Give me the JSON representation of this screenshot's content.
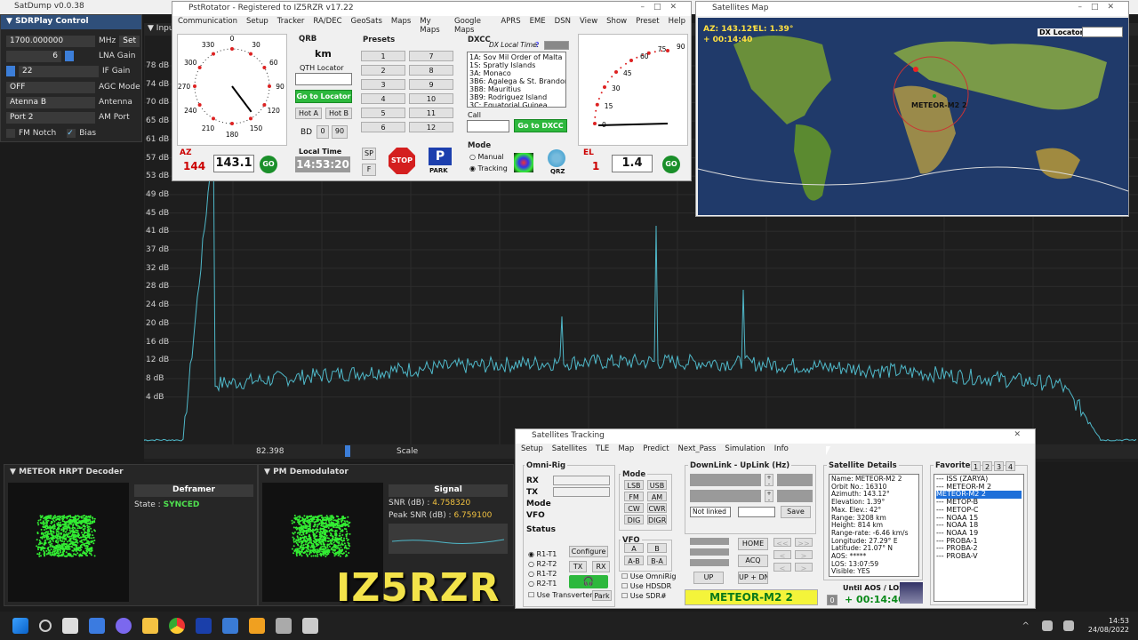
{
  "satdump": {
    "title": "SatDump v0.0.38"
  },
  "sdr": {
    "title": "SDRPlay Control",
    "freq": "1700.000000",
    "freq_unit": "MHz",
    "set": "Set",
    "lna_value": "6",
    "lna_label": "LNA Gain",
    "if_value": "22",
    "if_label": "IF Gain",
    "agc_value": "OFF",
    "agc_label": "AGC Mode",
    "antenna_value": "Atenna B",
    "antenna_label": "Antenna",
    "amport_value": "Port 2",
    "amport_label": "AM Port",
    "fmnotch": "FM Notch",
    "bias": "Bias"
  },
  "spectrum": {
    "input_label": "Inpu",
    "db_labels": [
      "78 dB",
      "74 dB",
      "70 dB",
      "65 dB",
      "61 dB",
      "57 dB",
      "53 dB",
      "49 dB",
      "45 dB",
      "41 dB",
      "37 dB",
      "32 dB",
      "28 dB",
      "24 dB",
      "20 dB",
      "16 dB",
      "12 dB",
      "8 dB",
      "4 dB"
    ],
    "offset": "82.398",
    "scale": "Scale"
  },
  "hrpt": {
    "title": "METEOR HRPT Decoder",
    "deframer": "Deframer",
    "state_label": "State :",
    "state_value": "SYNCED"
  },
  "pm": {
    "title": "PM Demodulator",
    "signal": "Signal",
    "snr_label": "SNR (dB) :",
    "snr_value": "4.758320",
    "peak_label": "Peak SNR (dB) :",
    "peak_value": "6.759100"
  },
  "callsign": "IZ5RZR",
  "rotator": {
    "title": "PstRotator - Registered to IZ5RZR  v17.22",
    "menu": [
      "Communication",
      "Setup",
      "Tracker",
      "RA/DEC",
      "GeoSats",
      "Maps",
      "My Maps",
      "Google Maps",
      "APRS",
      "EME",
      "DSN",
      "View",
      "Show",
      "Preset",
      "Help"
    ],
    "az_ticks": [
      "0",
      "30",
      "60",
      "90",
      "120",
      "150",
      "180",
      "210",
      "240",
      "270",
      "300",
      "330"
    ],
    "az_label": "AZ",
    "az_current": "144",
    "az_target": "143.1",
    "go": "GO",
    "qrb": "QRB",
    "qrb_unit": "km",
    "qth": "QTH Locator",
    "go_locator": "Go to Locator",
    "hot_a": "Hot A",
    "hot_b": "Hot B",
    "bd": "BD",
    "bd0": "0",
    "bd90": "90",
    "local_time_label": "Local Time",
    "local_time": "14:53:20",
    "presets": "Presets",
    "preset_nums": [
      "1",
      "7",
      "2",
      "8",
      "3",
      "9",
      "4",
      "10",
      "5",
      "11",
      "6",
      "12"
    ],
    "sp": "SP",
    "f": "F",
    "stop": "STOP",
    "park": "PARK",
    "dxcc": "DXCC",
    "dx_local_time": "DX Local Time:",
    "q": "?",
    "dxcc_list": [
      "1A:  Sov Mil Order of Malta",
      "1S:  Spratly Islands",
      "3A:  Monaco",
      "3B6: Agalega & St. Brandon",
      "3B8: Mauritius",
      "3B9: Rodriguez Island",
      "3C:  Equatorial Guinea"
    ],
    "call": "Call",
    "go_dxcc": "Go to DXCC",
    "mode": "Mode",
    "manual": "Manual",
    "tracking": "Tracking",
    "qrz": "QRZ",
    "el_ticks": [
      "90",
      "75",
      "60",
      "45",
      "30",
      "15",
      "0"
    ],
    "el_label": "EL",
    "el_current": "1",
    "el_target": "1.4"
  },
  "satmap": {
    "title": "Satellites Map",
    "az": "AZ: 143.12°",
    "el": "EL: 1.39°",
    "timer": "+ 00:14:40",
    "dx_locator": "DX Locator:",
    "sat_name": "METEOR-M2 2"
  },
  "tracking": {
    "title": "Satellites Tracking",
    "menu": [
      "Setup",
      "Satellites",
      "TLE",
      "Map",
      "Predict",
      "Next_Pass",
      "Simulation",
      "Info"
    ],
    "omnirig": "Omni-Rig",
    "rx": "RX",
    "tx": "TX",
    "mode": "Mode",
    "vfo": "VFO",
    "status": "Status",
    "r1t1": "R1-T1",
    "r2t2": "R2-T2",
    "r1t2": "R1-T2",
    "r2t1": "R2-T1",
    "configure": "Configure",
    "tx_btn": "TX",
    "rx_btn": "RX",
    "use_transverter": "Use Transverter",
    "park": "Park",
    "mode_title": "Mode",
    "modes": [
      "LSB",
      "USB",
      "FM",
      "AM",
      "CW",
      "CWR",
      "DIG",
      "DIGR"
    ],
    "vfo_title": "VFO",
    "vfo_btns": [
      "A",
      "B",
      "A-B",
      "B-A"
    ],
    "use_omnirig": "Use OmniRig",
    "use_hdsdr": "Use HDSDR",
    "use_sdr": "Use SDR#",
    "downlink": "DownLink - UpLink (Hz)",
    "not_linked": "Not linked",
    "save": "Save",
    "home": "HOME",
    "acq": "ACQ",
    "up": "UP",
    "updn": "UP + DN",
    "sat_name": "METEOR-M2 2",
    "details_title": "Satellite Details",
    "details": [
      "Name: METEOR-M2 2",
      "Orbit No.: 16310",
      "Azimuth: 143.12°",
      "Elevation: 1.39°",
      "Max. Elev.: 42°",
      "Range: 3208 km",
      "Height: 814 km",
      "Range-rate: -6.46 km/s",
      "Longitude: 27.29° E",
      "Latitude: 21.07° N",
      "AOS: *****",
      "LOS: 13:07:59",
      "Visible: YES"
    ],
    "until": "Until AOS / LOS",
    "countdown_num": "0",
    "countdown": "+ 00:14:40",
    "favorites": "Favorites",
    "fav_tabs": [
      "1",
      "2",
      "3",
      "4"
    ],
    "fav_list": [
      "--- ISS (ZARYA)",
      "--- METEOR-M 2",
      "METEOR-M2 2",
      "--- METOP-B",
      "--- METOP-C",
      "--- NOAA 15",
      "--- NOAA 18",
      "--- NOAA 19",
      "--- PROBA-1",
      "--- PROBA-2",
      "--- PROBA-V"
    ]
  },
  "taskbar": {
    "time": "14:53",
    "date": "24/08/2022"
  }
}
